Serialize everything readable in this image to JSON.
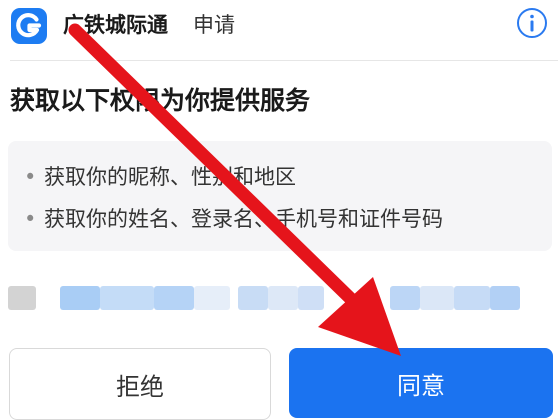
{
  "header": {
    "app_name": "广铁城际通",
    "apply_label": "申请",
    "logo_icon": "app-logo-icon",
    "info_icon": "info-icon"
  },
  "permissions": {
    "title": "获取以下权限为你提供服务",
    "items": [
      {
        "bullet": "•",
        "label": "获取你的昵称、性别和地区"
      },
      {
        "bullet": "•",
        "label": "获取你的姓名、登录名、手机号和证件号码"
      }
    ]
  },
  "actions": {
    "reject_label": "拒绝",
    "agree_label": "同意"
  },
  "colors": {
    "brand_blue": "#1b73f0",
    "annotation_red": "#e5141b",
    "panel_bg": "#f5f5f7"
  }
}
